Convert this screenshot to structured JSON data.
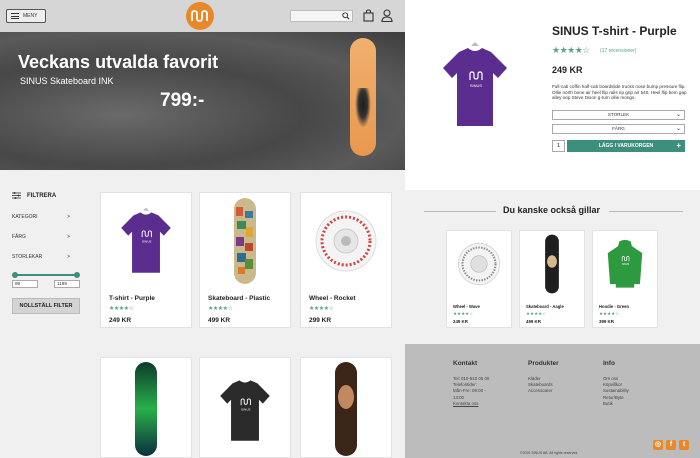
{
  "header": {
    "menu_label": "MENY",
    "search_placeholder": ""
  },
  "hero": {
    "title": "Veckans utvalda favorit",
    "subtitle": "SINUS Skateboard INK",
    "price": "799:-"
  },
  "product_detail": {
    "title": "SINUS T-shirt - Purple",
    "rating": 4,
    "reviews": "(17 recensioner)",
    "price": "249 KR",
    "description": "Full-cab coffin half-cab boardslide trucks nose bump pressure flip. Ollie north bone air heel flip rails rip grip air 540. Heel flip bem gap alley oop Steve Dixon g-turn ollie mongo.",
    "size_select": "STORLEK",
    "color_select": "FÄRG",
    "quantity": "1",
    "add_to_cart": "LÄGG I VARUKORGEN",
    "plus": "+"
  },
  "filter": {
    "title": "FILTRERA",
    "rows": [
      {
        "label": "KATEGORI",
        "arrow": ">"
      },
      {
        "label": "FÄRG",
        "arrow": ">"
      },
      {
        "label": "STORLEKAR",
        "arrow": ">"
      }
    ],
    "price_min": "99",
    "price_max": "1199",
    "reset": "NOLLSTÄLL FILTER"
  },
  "products": [
    {
      "name": "T-shirt - Purple",
      "price": "249 KR",
      "stars": "★★★★☆"
    },
    {
      "name": "Skateboard - Plastic",
      "price": "499 KR",
      "stars": "★★★★☆"
    },
    {
      "name": "Wheel - Rocket",
      "price": "299 KR",
      "stars": "★★★★☆"
    }
  ],
  "recommendations": {
    "title": "Du kanske också gillar",
    "items": [
      {
        "name": "Wheel - Wave",
        "price": "249 KR",
        "stars": "★★★★☆"
      },
      {
        "name": "Skateboard - Aagle",
        "price": "499 KR",
        "stars": "★★★★☆"
      },
      {
        "name": "Hoodie - Green",
        "price": "399 KR",
        "stars": "★★★★☆"
      }
    ]
  },
  "footer": {
    "contact": {
      "title": "Kontakt",
      "lines": [
        "Tel: 010-510 05 00",
        "Telefontider:",
        "Mån-Fre: 09:00 -",
        "13:00"
      ],
      "link": "Kontakta oss"
    },
    "products": {
      "title": "Produkter",
      "lines": [
        "Kläder",
        "Skateboards",
        "Accessoarer"
      ]
    },
    "info": {
      "title": "Info",
      "lines": [
        "Om oss",
        "Köpvillkor",
        "Sustainability",
        "Retur/Byte",
        "Butik"
      ]
    },
    "copyright": "©2020 SINUS AB. All rights reserved."
  },
  "colors": {
    "accent": "#3b8f7c",
    "brand": "#e8882a",
    "purple": "#5b2d8e"
  }
}
